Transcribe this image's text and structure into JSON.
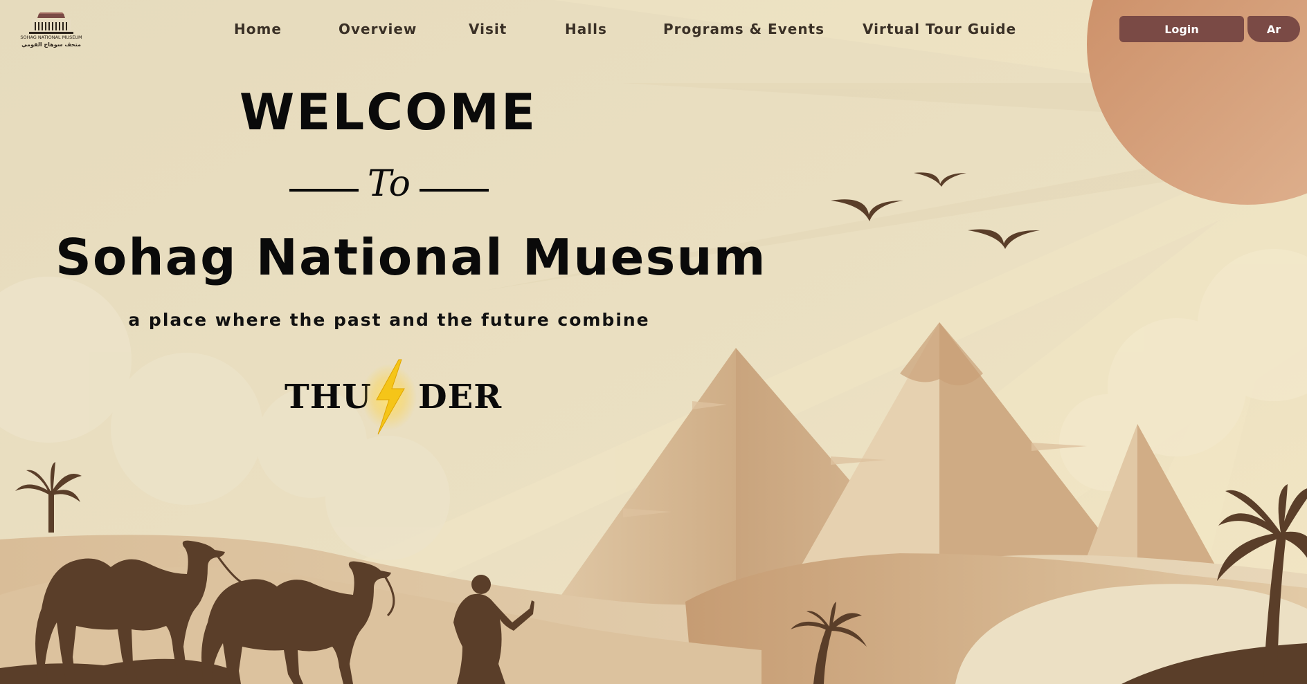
{
  "nav": {
    "logo": {
      "text_en": "SOHAG NATIONAL MUSEUM",
      "text_ar": "متحف سوهاج القومي"
    },
    "links": [
      {
        "label": "Home"
      },
      {
        "label": "Overview"
      },
      {
        "label": "Visit"
      },
      {
        "label": "Halls"
      },
      {
        "label": "Programs & Events"
      },
      {
        "label": "Virtual Tour Guide"
      }
    ],
    "login_label": "Login",
    "lang_label": "Ar"
  },
  "hero": {
    "welcome": "WELCOME",
    "to": "To",
    "title": "Sohag National Muesum",
    "subtitle": "a place where the past and the future combine",
    "brand_left": "THU",
    "brand_right": "DER",
    "brand_icon": "lightning-bolt-icon"
  },
  "colors": {
    "background": "#e8dfc4",
    "button": "#7a4a45",
    "silhouette": "#5a3e29",
    "sun": "#d29a74",
    "text": "#0a0a0a"
  }
}
